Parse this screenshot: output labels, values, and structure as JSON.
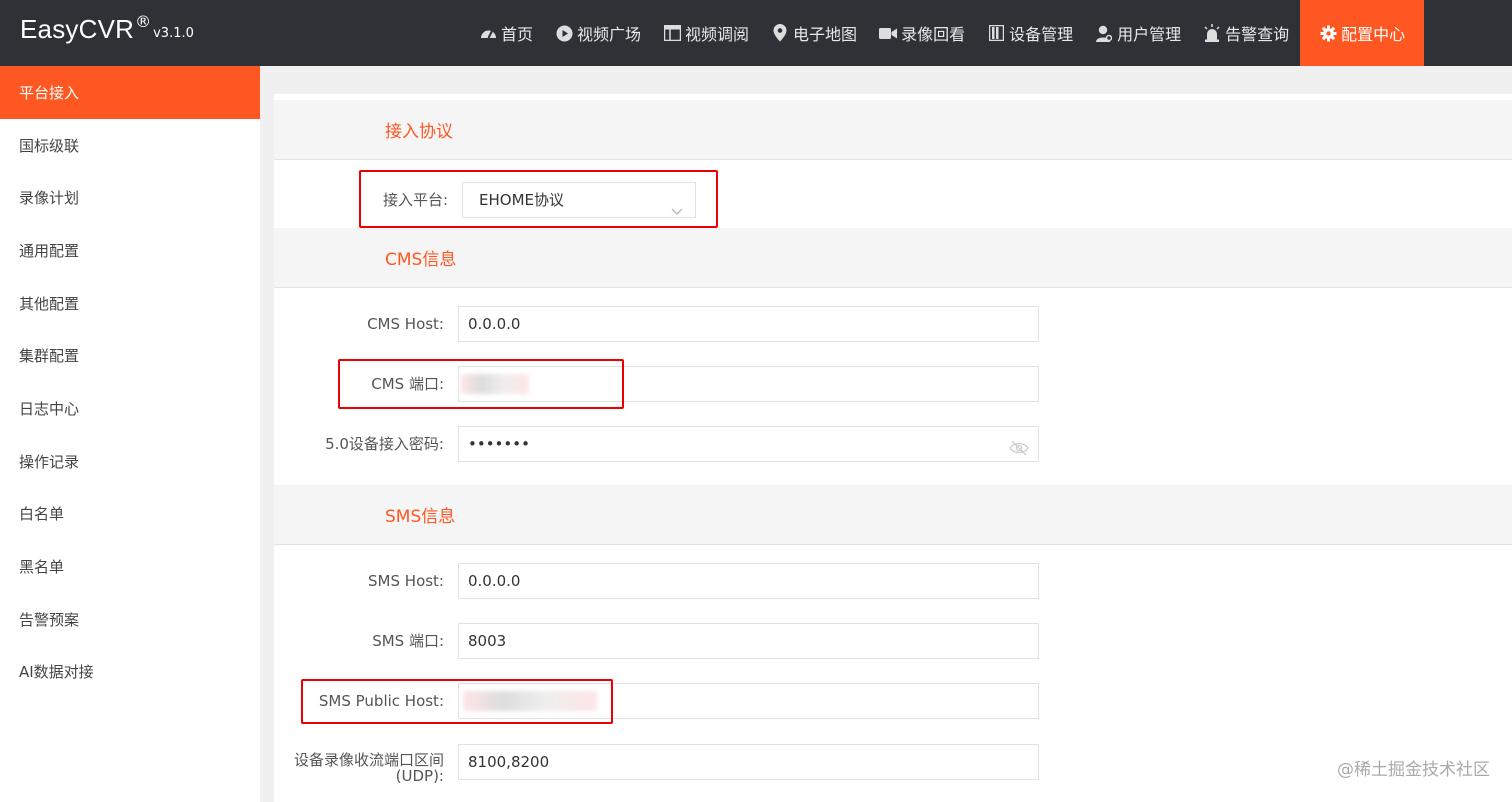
{
  "brand": {
    "name": "EasyCVR",
    "reg": "®",
    "version": "v3.1.0"
  },
  "nav": [
    {
      "label": "首页",
      "icon": "dashboard-icon"
    },
    {
      "label": "视频广场",
      "icon": "play-icon"
    },
    {
      "label": "视频调阅",
      "icon": "layout-icon"
    },
    {
      "label": "电子地图",
      "icon": "map-pin-icon"
    },
    {
      "label": "录像回看",
      "icon": "video-camera-icon"
    },
    {
      "label": "设备管理",
      "icon": "device-icon"
    },
    {
      "label": "用户管理",
      "icon": "user-icon"
    },
    {
      "label": "告警查询",
      "icon": "alarm-icon"
    },
    {
      "label": "配置中心",
      "icon": "gear-icon",
      "active": true
    }
  ],
  "sidebar": {
    "items": [
      {
        "label": "平台接入",
        "active": true
      },
      {
        "label": "国标级联"
      },
      {
        "label": "录像计划"
      },
      {
        "label": "通用配置"
      },
      {
        "label": "其他配置"
      },
      {
        "label": "集群配置"
      },
      {
        "label": "日志中心"
      },
      {
        "label": "操作记录"
      },
      {
        "label": "白名单"
      },
      {
        "label": "黑名单"
      },
      {
        "label": "告警预案"
      },
      {
        "label": "AI数据对接"
      }
    ]
  },
  "sections": {
    "protocol": {
      "title": "接入协议",
      "platform_label": "接入平台:",
      "platform_value": "EHOME协议"
    },
    "cms": {
      "title": "CMS信息",
      "host_label": "CMS Host:",
      "host_value": "0.0.0.0",
      "port_label": "CMS 端口:",
      "port_value": "",
      "password_label": "5.0设备接入密码:",
      "password_value": "•••••••"
    },
    "sms": {
      "title": "SMS信息",
      "host_label": "SMS Host:",
      "host_value": "0.0.0.0",
      "port_label": "SMS 端口:",
      "port_value": "8003",
      "public_host_label": "SMS Public Host:",
      "public_host_value": "",
      "udp_label_line1": "设备录像收流端口区间",
      "udp_label_line2": "(UDP):",
      "udp_value": "8100,8200"
    }
  },
  "watermark": "@稀土掘金技术社区",
  "colors": {
    "accent": "#ff5722",
    "topbar": "#2e3136",
    "highlight": "#e00000"
  }
}
